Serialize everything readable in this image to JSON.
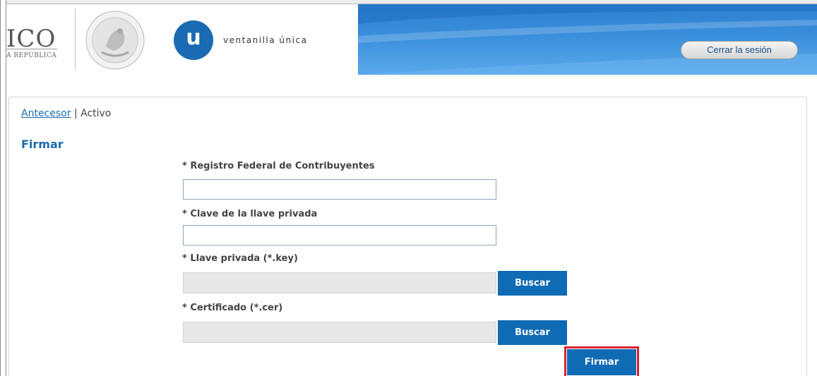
{
  "header": {
    "gob_text": "ICO",
    "gob_subtext": "A REPÚBLICA",
    "app_logo_letter": "u",
    "app_name": "ventanilla única",
    "logout_label": "Cerrar la sesión"
  },
  "breadcrumb": {
    "link": "Antecesor",
    "separator": " | ",
    "current": "Activo"
  },
  "page": {
    "title": "Firmar"
  },
  "form": {
    "rfc_label": "* Registro Federal de Contribuyentes",
    "rfc_value": "",
    "password_label": "* Clave de la llave privada",
    "password_value": "",
    "key_label": "* Llave privada (*.key)",
    "key_value": "",
    "key_browse_label": "Buscar",
    "cert_label": "* Certificado (*.cer)",
    "cert_value": "",
    "cert_browse_label": "Buscar",
    "sign_label": "Firmar"
  },
  "colors": {
    "accent": "#106bb5",
    "title": "#1a6bb2",
    "highlight": "#d9232d"
  }
}
